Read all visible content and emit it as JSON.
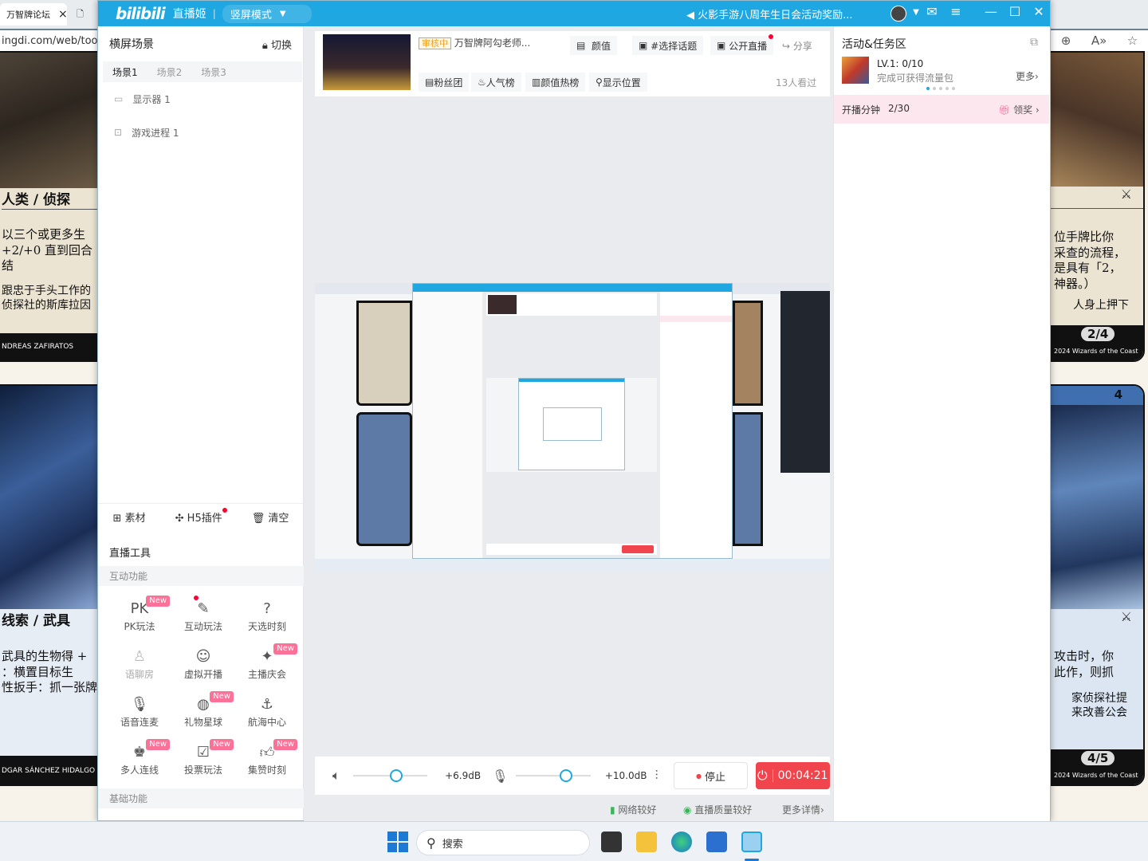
{
  "browser": {
    "tab1_title": "万智牌论坛",
    "tab1_close": "×",
    "url": "ingdi.com/web/tools",
    "toolbar_icons": [
      "zoom-icon",
      "read-aloud-icon",
      "favorite-icon"
    ],
    "cards": {
      "tl_type": "人类 / 侦探",
      "tl_text1": "以三个或更多生",
      "tl_text2": "+2/+0 直到回合结",
      "tl_flavor1": "跟忠于手头工作的",
      "tl_flavor2": "侦探社的斯库拉因",
      "tl_artist": "NDREAS ZAFIRATOS",
      "bl_type": "线索 / 武具",
      "bl_text1": "武具的生物得 +",
      "bl_text2": "：横置目标生",
      "bl_text3": "性扳手：抓一张牌",
      "bl_artist": "DGAR SÁNCHEZ HIDALGO",
      "tr_text1": "位手牌比你",
      "tr_text2": "采查的流程，",
      "tr_text3": "是具有「2，",
      "tr_text4": "神器。）",
      "tr_flavor": "人身上押下",
      "tr_pt": "2/4",
      "tr_copyright": "2024 Wizards of the Coast",
      "br_cost": "4",
      "br_text1": "攻击时，你",
      "br_text2": "此作，则抓",
      "br_flavor1": "家侦探社提",
      "br_flavor2": "来改善公会",
      "br_pt": "4/5",
      "br_copyright": "2024 Wizards of the Coast"
    }
  },
  "app": {
    "logo": "bilibili",
    "name": "直播姬",
    "mode": "竖屏模式",
    "notice": "火影手游八周年生日会活动奖励...",
    "colors": {
      "accent": "#1fa7e1",
      "pink": "#fb7299",
      "stop": "#f0454d"
    }
  },
  "left": {
    "title": "横屏场景",
    "switch": "切换",
    "scenes": [
      "场景1",
      "场景2",
      "场景3"
    ],
    "sources": [
      {
        "icon": "monitor-icon",
        "label": "显示器 1"
      },
      {
        "icon": "gamepad-icon",
        "label": "游戏进程 1"
      }
    ],
    "material": "素材",
    "h5": "H5插件",
    "clear": "清空",
    "tools_title": "直播工具",
    "interactive": "互动功能",
    "items": [
      {
        "label": "PK玩法",
        "icon": "pk-icon",
        "new": "New"
      },
      {
        "label": "互动玩法",
        "icon": "interactive-play-icon",
        "new": ""
      },
      {
        "label": "天选时刻",
        "icon": "lucky-draw-icon",
        "new": ""
      },
      {
        "label": "语聊房",
        "icon": "voice-room-icon",
        "new": ""
      },
      {
        "label": "虚拟开播",
        "icon": "virtual-live-icon",
        "new": ""
      },
      {
        "label": "主播庆会",
        "icon": "celebration-icon",
        "new": "New"
      },
      {
        "label": "语音连麦",
        "icon": "voice-link-icon",
        "new": ""
      },
      {
        "label": "礼物星球",
        "icon": "gift-planet-icon",
        "new": "New"
      },
      {
        "label": "航海中心",
        "icon": "anchor-icon",
        "new": ""
      },
      {
        "label": "多人连线",
        "icon": "multi-link-icon",
        "new": "New"
      },
      {
        "label": "投票玩法",
        "icon": "vote-icon",
        "new": "New"
      },
      {
        "label": "集赞时刻",
        "icon": "like-icon",
        "new": "New"
      }
    ],
    "basic": "基础功能"
  },
  "info": {
    "status_badge": "审核中",
    "title": "万智牌阿勾老师...",
    "category": "颜值",
    "topic": "#选择话题",
    "public": "公开直播",
    "share": "分享",
    "fans": "粉丝团",
    "popularity": "人气榜",
    "hot": "颜值热榜",
    "location": "显示位置",
    "viewers": "13人看过"
  },
  "controls": {
    "speaker_db": "+6.9dB",
    "speaker_level": 0.5,
    "mic_db": "+10.0dB",
    "mic_level": 0.58,
    "stop": "停止",
    "timer": "00:04:21"
  },
  "status": {
    "network": "网络较好",
    "quality": "直播质量较好",
    "details": "更多详情"
  },
  "right": {
    "title": "活动&任务区",
    "level": "LV.1: 0/10",
    "reward": "完成可获得流量包",
    "more": "更多",
    "task": "开播分钟",
    "task_progress": "2/30",
    "claim": "领奖"
  },
  "taskbar": {
    "search": "搜索"
  }
}
